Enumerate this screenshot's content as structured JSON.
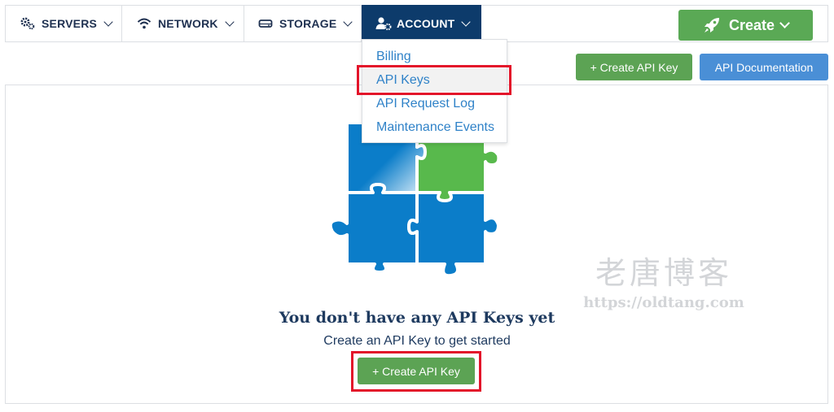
{
  "nav": {
    "items": [
      {
        "label": "SERVERS",
        "icon": "gears-icon"
      },
      {
        "label": "NETWORK",
        "icon": "wifi-icon"
      },
      {
        "label": "STORAGE",
        "icon": "drive-icon"
      },
      {
        "label": "ACCOUNT",
        "icon": "user-gear-icon",
        "active": true
      }
    ],
    "create_label": "Create",
    "create_icon": "rocket-icon"
  },
  "dropdown": {
    "items": [
      {
        "label": "Billing"
      },
      {
        "label": "API Keys",
        "selected": true
      },
      {
        "label": "API Request Log"
      },
      {
        "label": "Maintenance Events"
      }
    ]
  },
  "toolbar": {
    "create_api_key": "+ Create API Key",
    "api_documentation": "API Documentation"
  },
  "empty_state": {
    "illustration": "puzzle-pieces-illustration",
    "title": "You don't have any API Keys yet",
    "subtitle": "Create an API Key to get started",
    "button": "+ Create API Key"
  },
  "watermark": {
    "text_cn": "老唐博客",
    "url": "https://oldtang.com"
  },
  "colors": {
    "nav_active": "#0d3b6b",
    "green": "#5aa955",
    "blue": "#4a8fd6",
    "link": "#2f82c8",
    "highlight": "#e3142a",
    "puzzle_blue": "#0b7dc9",
    "puzzle_green": "#58b94c"
  }
}
